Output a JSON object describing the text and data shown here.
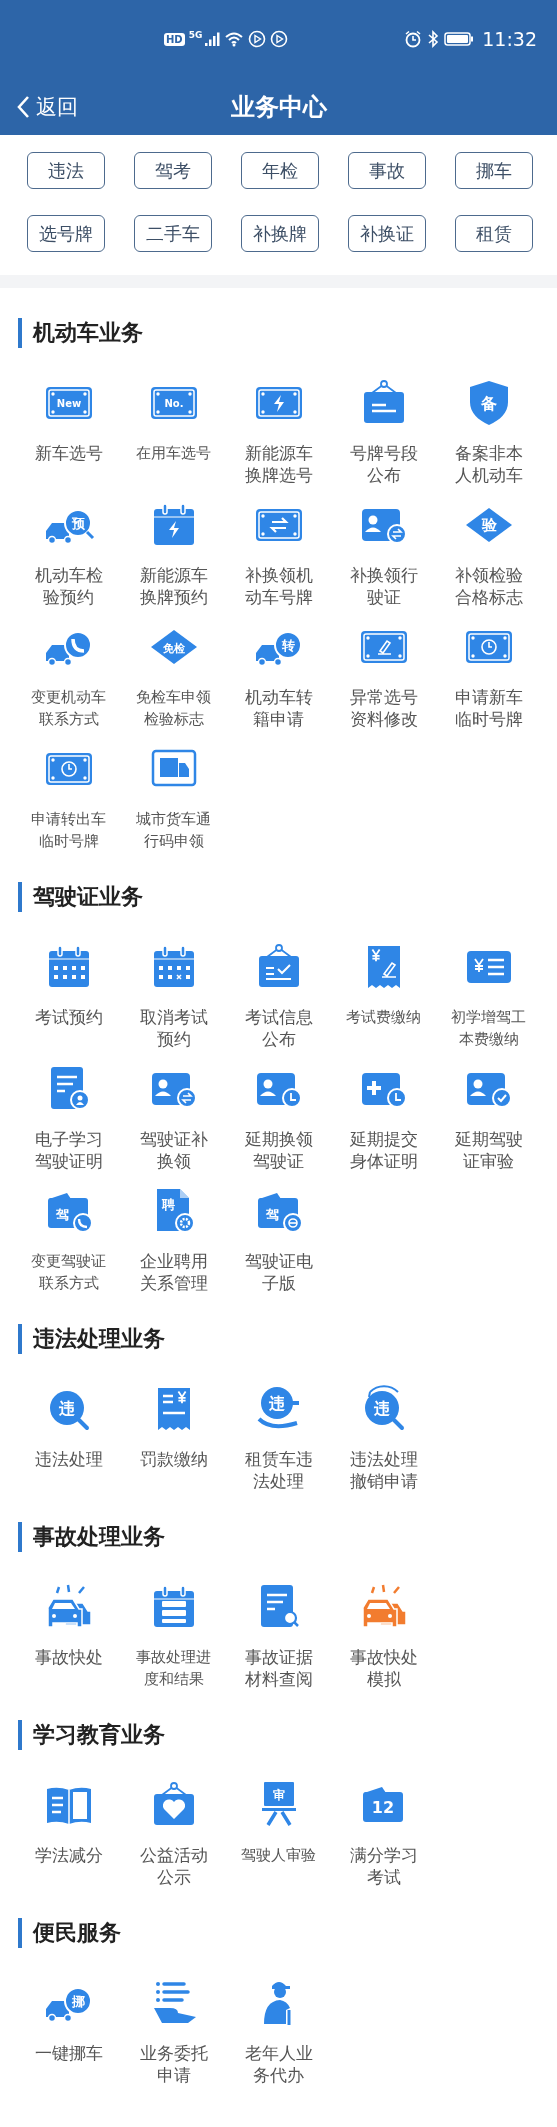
{
  "status_bar": {
    "network_badges": [
      "HD",
      "5G"
    ],
    "time": "11:32"
  },
  "nav": {
    "back": "返回",
    "title": "业务中心"
  },
  "quick_links": [
    {
      "label": "违法"
    },
    {
      "label": "驾考"
    },
    {
      "label": "年检"
    },
    {
      "label": "事故"
    },
    {
      "label": "挪车"
    },
    {
      "label": "选号牌"
    },
    {
      "label": "二手车"
    },
    {
      "label": "补换牌"
    },
    {
      "label": "补换证"
    },
    {
      "label": "租赁"
    }
  ],
  "sections": [
    {
      "title": "机动车业务",
      "items": [
        {
          "label": "新车选号",
          "badge": "New"
        },
        {
          "label": "在用车选号",
          "badge": "No."
        },
        {
          "label": "新能源车换牌选号"
        },
        {
          "label": "号牌号段公布"
        },
        {
          "label": "备案非本人机动车",
          "badge": "备"
        },
        {
          "label": "机动车检验预约",
          "badge": "预"
        },
        {
          "label": "新能源车换牌预约"
        },
        {
          "label": "补换领机动车号牌"
        },
        {
          "label": "补换领行驶证"
        },
        {
          "label": "补领检验合格标志",
          "badge": "验"
        },
        {
          "label": "变更机动车联系方式"
        },
        {
          "label": "免检车申领检验标志",
          "badge": "免检"
        },
        {
          "label": "机动车转籍申请",
          "badge": "转"
        },
        {
          "label": "异常选号资料修改"
        },
        {
          "label": "申请新车临时号牌"
        },
        {
          "label": "申请转出车临时号牌"
        },
        {
          "label": "城市货车通行码申领"
        }
      ]
    },
    {
      "title": "驾驶证业务",
      "items": [
        {
          "label": "考试预约"
        },
        {
          "label": "取消考试预约"
        },
        {
          "label": "考试信息公布"
        },
        {
          "label": "考试费缴纳"
        },
        {
          "label": "初学增驾工本费缴纳"
        },
        {
          "label": "电子学习驾驶证明"
        },
        {
          "label": "驾驶证补换领"
        },
        {
          "label": "延期换领驾驶证"
        },
        {
          "label": "延期提交身体证明"
        },
        {
          "label": "延期驾驶证审验"
        },
        {
          "label": "变更驾驶证联系方式",
          "badge": "驾"
        },
        {
          "label": "企业聘用关系管理",
          "badge": "聘"
        },
        {
          "label": "驾驶证电子版",
          "badge": "驾"
        }
      ]
    },
    {
      "title": "违法处理业务",
      "items": [
        {
          "label": "违法处理",
          "badge": "违"
        },
        {
          "label": "罚款缴纳"
        },
        {
          "label": "租赁车违法处理",
          "badge": "违"
        },
        {
          "label": "违法处理撤销申请",
          "badge": "违"
        }
      ]
    },
    {
      "title": "事故处理业务",
      "items": [
        {
          "label": "事故快处",
          "color": "#2f86e6"
        },
        {
          "label": "事故处理进度和结果",
          "color": "#2f86e6"
        },
        {
          "label": "事故证据材料查阅",
          "color": "#2f86e6"
        },
        {
          "label": "事故快处模拟",
          "color": "#f27c2f"
        }
      ]
    },
    {
      "title": "学习教育业务",
      "items": [
        {
          "label": "学法减分"
        },
        {
          "label": "公益活动公示"
        },
        {
          "label": "驾驶人审验",
          "badge": "审"
        },
        {
          "label": "满分学习考试",
          "badge": "12"
        }
      ]
    },
    {
      "title": "便民服务",
      "items": [
        {
          "label": "一键挪车",
          "badge": "挪"
        },
        {
          "label": "业务委托申请"
        },
        {
          "label": "老年人业务代办"
        }
      ]
    }
  ]
}
